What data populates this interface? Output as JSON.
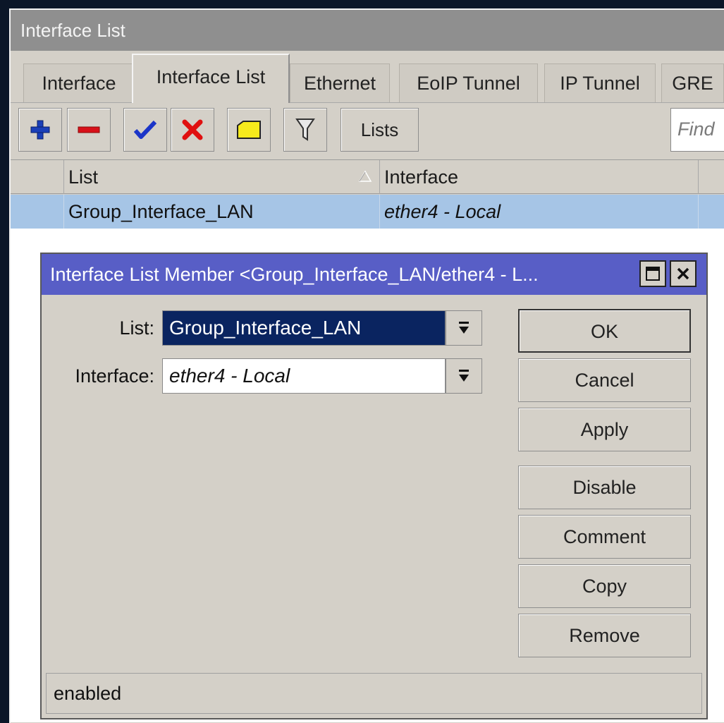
{
  "window": {
    "title": "Interface List"
  },
  "tabs": [
    "Interface",
    "Interface List",
    "Ethernet",
    "EoIP Tunnel",
    "IP Tunnel",
    "GRE"
  ],
  "toolbar": {
    "icons": [
      "plus-icon",
      "minus-icon",
      "check-icon",
      "cross-icon",
      "note-icon",
      "filter-icon"
    ],
    "lists_label": "Lists",
    "find_placeholder": "Find"
  },
  "table": {
    "columns": [
      "List",
      "Interface"
    ],
    "rows": [
      {
        "list": "Group_Interface_LAN",
        "interface": "ether4 - Local"
      }
    ]
  },
  "dialog": {
    "title": "Interface List Member <Group_Interface_LAN/ether4 - L...",
    "fields": {
      "list_label": "List:",
      "list_value": "Group_Interface_LAN",
      "interface_label": "Interface:",
      "interface_value": "ether4 - Local"
    },
    "buttons": [
      "OK",
      "Cancel",
      "Apply",
      "Disable",
      "Comment",
      "Copy",
      "Remove"
    ],
    "status": "enabled"
  },
  "colors": {
    "dialog_title_bg": "#585ec6",
    "selected_row_bg": "#a6c5e6",
    "list_field_bg": "#0a2460"
  }
}
